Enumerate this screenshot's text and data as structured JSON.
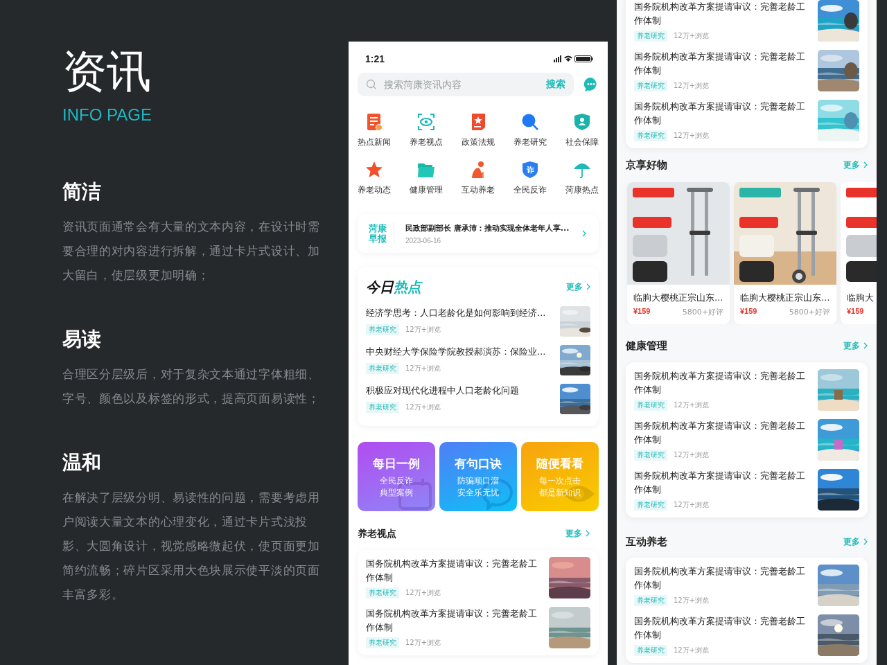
{
  "intro": {
    "title": "资讯",
    "subtitle": "INFO PAGE",
    "sections": [
      {
        "heading": "简洁",
        "body": "资讯页面通常会有大量的文本内容，在设计时需要合理的对内容进行拆解，通过卡片式设计、加大留白，使层级更加明确；"
      },
      {
        "heading": "易读",
        "body": "合理区分层级后，对于复杂文本通过字体粗细、字号、颜色以及标签的形式，提高页面易读性；"
      },
      {
        "heading": "温和",
        "body": "在解决了层级分明、易读性的问题，需要考虑用户阅读大量文本的心理变化，通过卡片式浅投影、大圆角设计，视觉感略微起伏，使页面更加简约流畅；碎片区采用大色块展示使平淡的页面丰富多彩。"
      }
    ]
  },
  "phone_home": {
    "status_bar": {
      "time": "1:21"
    },
    "search": {
      "placeholder": "搜索菏康资讯内容",
      "button": "搜索"
    },
    "categories": [
      {
        "label": "热点新闻",
        "kind": "news"
      },
      {
        "label": "养老视点",
        "kind": "eye"
      },
      {
        "label": "政策法规",
        "kind": "book"
      },
      {
        "label": "养老研究",
        "kind": "magnifier"
      },
      {
        "label": "社会保障",
        "kind": "shield"
      },
      {
        "label": "养老动态",
        "kind": "star"
      },
      {
        "label": "健康管理",
        "kind": "folder"
      },
      {
        "label": "互动养老",
        "kind": "elder"
      },
      {
        "label": "全民反诈",
        "kind": "badge",
        "badge": "诈"
      },
      {
        "label": "菏康热点",
        "kind": "umbrella"
      }
    ],
    "briefing": {
      "label": "菏康早报",
      "headline": "民政部副部长 唐承沛：推动实现全体老年人享...",
      "date": "2023-06-16"
    },
    "today_hot": {
      "title": "今日",
      "title_highlight": "热点",
      "more": "更多",
      "articles": [
        {
          "title": "经济学思考：人口老龄化是如何影响到经济...",
          "tag": "养老研究",
          "views": "12万+浏览"
        },
        {
          "title": "中央财经大学保险学院教授郝演苏：保险业...",
          "tag": "养老研究",
          "views": "12万+浏览"
        },
        {
          "title": "积极应对现代化进程中人口老龄化问题",
          "tag": "养老研究",
          "views": "12万+浏览"
        }
      ]
    },
    "promo_cards": [
      {
        "kind": "purple",
        "title": "每日一例",
        "lines": [
          "全民反诈",
          "典型案例"
        ]
      },
      {
        "kind": "blue",
        "title": "有句口诀",
        "lines": [
          "防骗顺口溜",
          "安全乐无忧"
        ]
      },
      {
        "kind": "orange",
        "title": "随便看看",
        "lines": [
          "每一次点击",
          "都是新知识"
        ]
      }
    ],
    "elder_views": {
      "title": "养老视点",
      "more": "更多",
      "articles": [
        {
          "title": "国务院机构改革方案提请审议：完善老龄工作体制",
          "tag": "养老研究",
          "views": "12万+浏览"
        },
        {
          "title": "国务院机构改革方案提请审议：完善老龄工作体制",
          "tag": "养老研究",
          "views": "12万+浏览"
        }
      ]
    }
  },
  "phone_feed": {
    "top_articles": [
      {
        "title": "国务院机构改革方案提请审议：完善老龄工作体制",
        "tag": "养老研究",
        "views": "12万+浏览"
      },
      {
        "title": "国务院机构改革方案提请审议：完善老龄工作体制",
        "tag": "养老研究",
        "views": "12万+浏览"
      },
      {
        "title": "国务院机构改革方案提请审议：完善老龄工作体制",
        "tag": "养老研究",
        "views": "12万+浏览"
      }
    ],
    "shop": {
      "title": "京享好物",
      "more": "更多",
      "products": [
        {
          "title": "临朐大樱桃正宗山东…",
          "price": "¥159",
          "reviews": "5800+好评"
        },
        {
          "title": "临朐大樱桃正宗山东…",
          "price": "¥159",
          "reviews": "5800+好评"
        },
        {
          "title": "临朐大",
          "price": "¥159"
        }
      ]
    },
    "health": {
      "title": "健康管理",
      "more": "更多",
      "articles": [
        {
          "title": "国务院机构改革方案提请审议：完善老龄工作体制",
          "tag": "养老研究",
          "views": "12万+浏览"
        },
        {
          "title": "国务院机构改革方案提请审议：完善老龄工作体制",
          "tag": "养老研究",
          "views": "12万+浏览"
        },
        {
          "title": "国务院机构改革方案提请审议：完善老龄工作体制",
          "tag": "养老研究",
          "views": "12万+浏览"
        }
      ]
    },
    "interactive": {
      "title": "互动养老",
      "more": "更多",
      "articles": [
        {
          "title": "国务院机构改革方案提请审议：完善老龄工作体制",
          "tag": "养老研究",
          "views": "12万+浏览"
        },
        {
          "title": "国务院机构改革方案提请审议：完善老龄工作体制",
          "tag": "养老研究",
          "views": "12万+浏览"
        }
      ]
    }
  }
}
